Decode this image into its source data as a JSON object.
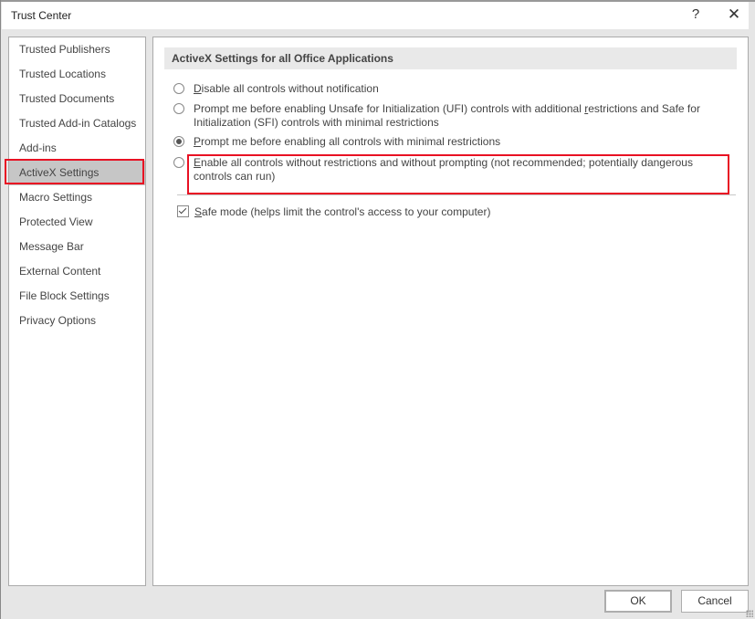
{
  "window": {
    "title": "Trust Center",
    "help_label": "?",
    "close_label": "✕"
  },
  "sidebar": {
    "selected_index": 5,
    "items": [
      {
        "label": "Trusted Publishers"
      },
      {
        "label": "Trusted Locations"
      },
      {
        "label": "Trusted Documents"
      },
      {
        "label": "Trusted Add-in Catalogs"
      },
      {
        "label": "Add-ins"
      },
      {
        "label": "ActiveX Settings"
      },
      {
        "label": "Macro Settings"
      },
      {
        "label": "Protected View"
      },
      {
        "label": "Message Bar"
      },
      {
        "label": "External Content"
      },
      {
        "label": "File Block Settings"
      },
      {
        "label": "Privacy Options"
      }
    ]
  },
  "main": {
    "section_title": "ActiveX Settings for all Office Applications",
    "options": [
      {
        "accel": "D",
        "rest": "isable all controls without notification",
        "checked": false
      },
      {
        "pre": "Prompt me before enabling Unsafe for Initialization (UFI) controls with additional ",
        "accel": "r",
        "rest": "estrictions and Safe for Initialization (SFI) controls with minimal restrictions",
        "checked": false
      },
      {
        "accel": "P",
        "rest": "rompt me before enabling all controls with minimal restrictions",
        "checked": true
      },
      {
        "accel": "E",
        "rest": "nable all controls without restrictions and without prompting (not recommended; potentially dangerous controls can run)",
        "checked": false
      }
    ],
    "safe_mode": {
      "accel": "S",
      "rest": "afe mode (helps limit the control's access to your computer)",
      "checked": true
    }
  },
  "footer": {
    "ok_label": "OK",
    "cancel_label": "Cancel"
  },
  "colors": {
    "highlight_outline": "#e81123",
    "selected_nav_bg": "#c6c6c6"
  }
}
